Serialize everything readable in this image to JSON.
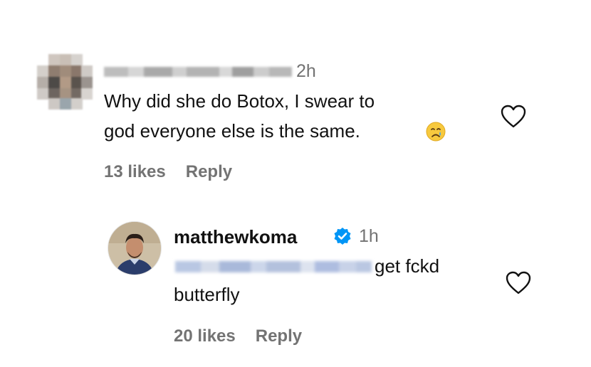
{
  "comment1": {
    "time": "2h",
    "text_line1": "Why did she do Botox, I swear to",
    "text_line2": "god everyone else is the same.",
    "emoji": "crying-face",
    "likes": "13 likes",
    "reply": "Reply"
  },
  "reply1": {
    "username": "matthewkoma",
    "time": "1h",
    "text_after_mention": "get fckd",
    "text_line2": "butterfly",
    "likes": "20 likes",
    "reply": "Reply"
  },
  "colors": {
    "verified": "#0095f6",
    "muted": "#737373",
    "text": "#111111"
  }
}
